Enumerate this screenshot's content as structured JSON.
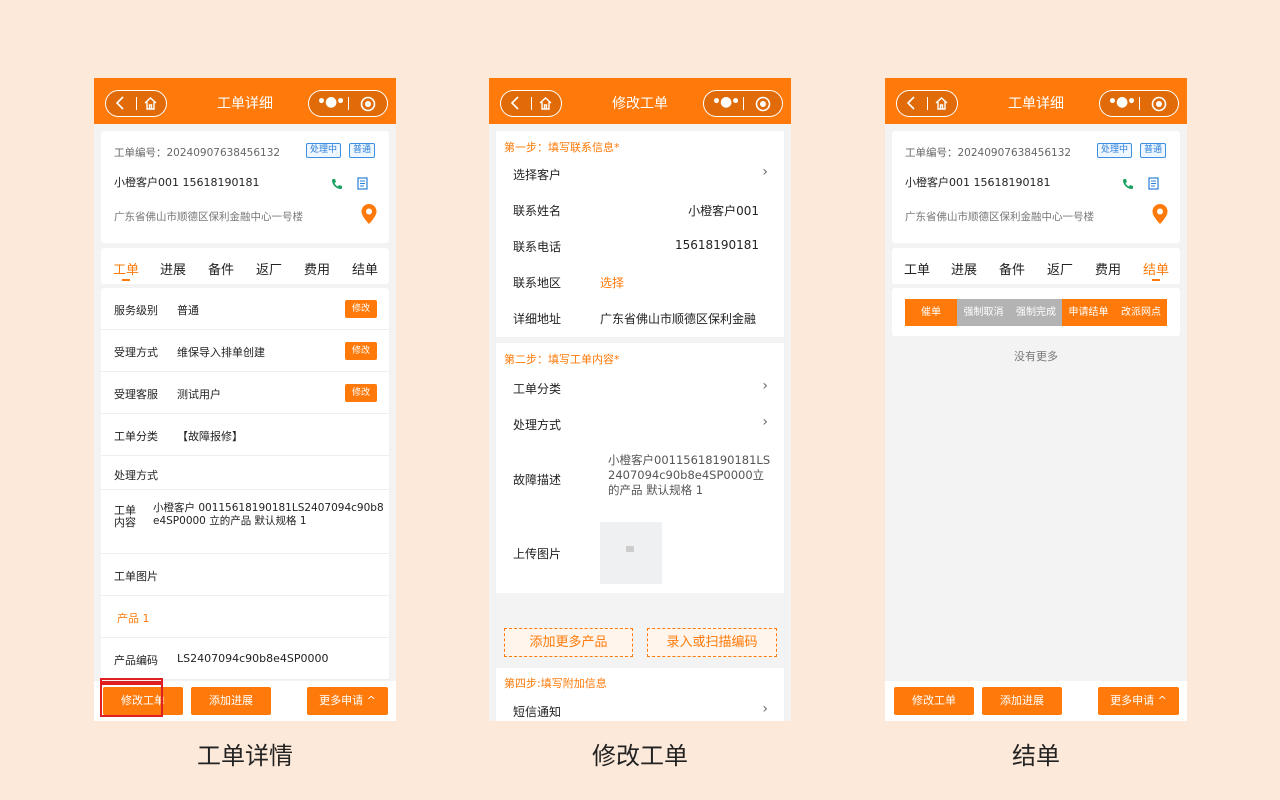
{
  "screens": {
    "detail": {
      "nav_title": "工单详细",
      "order_no": "工单编号：20240907638456132",
      "tag_status": "处理中",
      "tag_level": "普通",
      "customer": "小橙客户001 15618190181",
      "address": "广东省佛山市顺德区保利金融中心一号楼",
      "tabs": [
        "工单",
        "进展",
        "备件",
        "返厂",
        "费用",
        "结单"
      ],
      "rows": [
        {
          "k": "服务级别",
          "v": "普通",
          "btn": "修改"
        },
        {
          "k": "受理方式",
          "v": "维保导入排单创建",
          "btn": "修改"
        },
        {
          "k": "受理客服",
          "v": "测试用户",
          "btn": "修改"
        },
        {
          "k": "工单分类",
          "v": "【故障报修】"
        },
        {
          "k": "处理方式",
          "v": ""
        }
      ],
      "content_label_1": "工单",
      "content_label_2": "内容",
      "content_value": "小橙客户 00115618190181LS2407094c90b8e4SP0000 立的产品 默认规格 1",
      "image_label": "工单图片",
      "product_title": "产品 1",
      "product_code_label": "产品编码",
      "product_code_value": "LS2407094c90b8e4SP0000",
      "btn_modify": "修改工单",
      "btn_progress": "添加进展",
      "btn_more": "更多申请 ^"
    },
    "edit": {
      "nav_title": "修改工单",
      "step1": "第一步：填写联系信息*",
      "choose_customer": "选择客户",
      "contact_name_label": "联系姓名",
      "contact_name": "小橙客户001",
      "contact_phone_label": "联系电话",
      "contact_phone": "15618190181",
      "region_label": "联系地区",
      "region_value": "选择",
      "detail_addr_label": "详细地址",
      "detail_addr": "广东省佛山市顺德区保利金融",
      "step2": "第二步：填写工单内容*",
      "category_label": "工单分类",
      "method_label": "处理方式",
      "fault_label": "故障描述",
      "fault_value": "小橙客户00115618190181LS2407094c90b8e4SP0000立的产品 默认规格 1",
      "upload_label": "上传图片",
      "btn_add_product": "添加更多产品",
      "btn_scan": "录入或扫描编码",
      "step4": "第四步:填写附加信息",
      "sms_label": "短信通知"
    },
    "close": {
      "nav_title": "工单详细",
      "actions": [
        "催单",
        "强制取消",
        "强制完成",
        "申请结单",
        "改派网点"
      ],
      "no_more": "没有更多"
    }
  },
  "captions": [
    "工单详情",
    "修改工单",
    "结单"
  ],
  "colors": {
    "accent": "#ff7a0a",
    "background": "#fde9d9",
    "highlight": "#e02020"
  }
}
